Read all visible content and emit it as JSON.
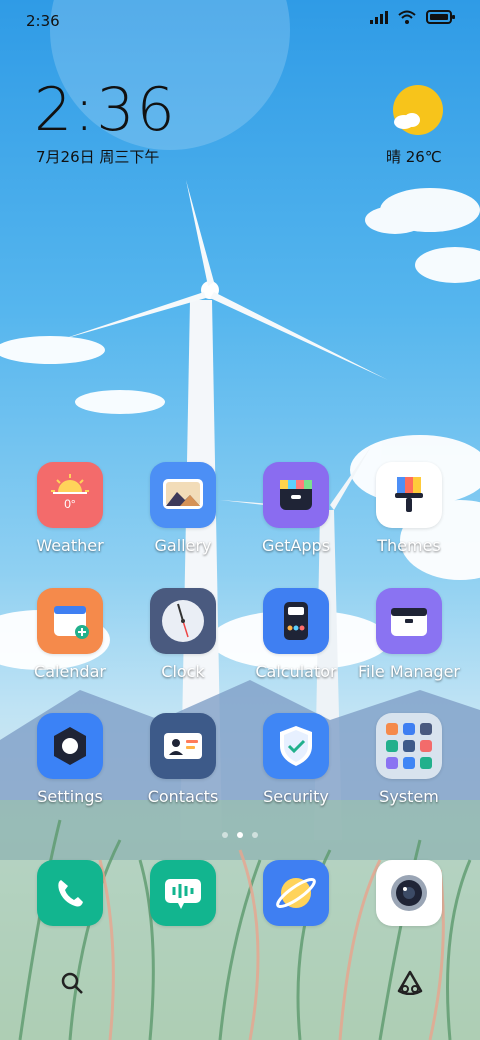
{
  "status_bar": {
    "time": "2:36"
  },
  "widget": {
    "time": "2:36",
    "date": "7月26日 周三下午",
    "weather": "晴 26℃"
  },
  "apps": [
    {
      "label": "Weather",
      "icon": "weather-icon",
      "color": "#f36b6b"
    },
    {
      "label": "Gallery",
      "icon": "gallery-icon",
      "color": "#4c8ff5"
    },
    {
      "label": "GetApps",
      "icon": "getapps-icon",
      "color": "#8a6cf0"
    },
    {
      "label": "Themes",
      "icon": "themes-icon",
      "color": "#ffffff"
    },
    {
      "label": "Calendar",
      "icon": "calendar-icon",
      "color": "#f58a4b"
    },
    {
      "label": "Clock",
      "icon": "clock-icon",
      "color": "#4a5a7f"
    },
    {
      "label": "Calculator",
      "icon": "calculator-icon",
      "color": "#3f7ff2"
    },
    {
      "label": "File Manager",
      "icon": "folder-icon",
      "color": "#8a73f2"
    },
    {
      "label": "Settings",
      "icon": "settings-icon",
      "color": "#3b82f6"
    },
    {
      "label": "Contacts",
      "icon": "contacts-icon",
      "color": "#3d5a89"
    },
    {
      "label": "Security",
      "icon": "security-icon",
      "color": "#3f86f5"
    },
    {
      "label": "System",
      "icon": "system-folder-icon",
      "color": "#d8e3ee"
    }
  ],
  "weather_tile_temp": "0°",
  "dock": [
    {
      "icon": "phone-icon",
      "color": "#12b58f"
    },
    {
      "icon": "messages-icon",
      "color": "#12b58f"
    },
    {
      "icon": "browser-icon",
      "color": "#3f7ff2"
    },
    {
      "icon": "camera-icon",
      "color": "#ffffff"
    }
  ]
}
